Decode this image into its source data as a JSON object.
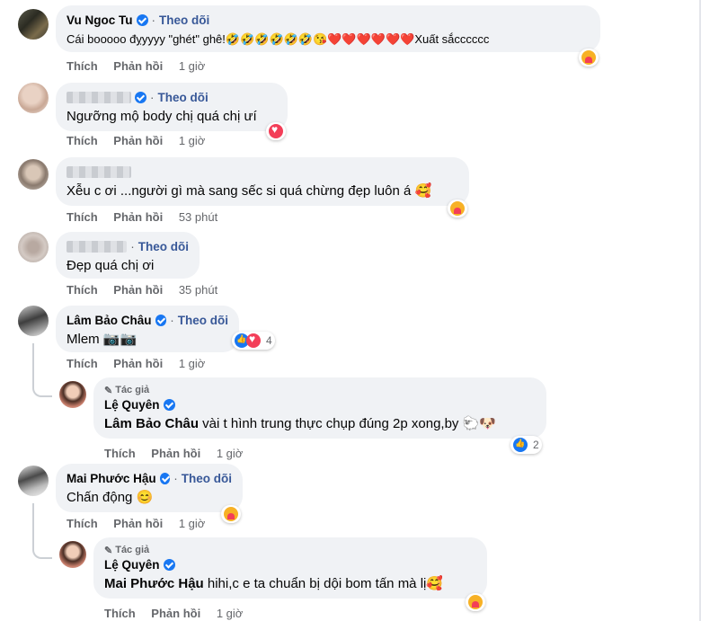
{
  "actions": {
    "like": "Thích",
    "reply": "Phản hồi"
  },
  "comments": [
    {
      "name": "Vu Ngoc Tu",
      "follow": "Theo dõi",
      "text": "Cái booooo đỵyyyy \"ghét\" ghê!🤣🤣🤣🤣🤣🤣😘❤️❤️❤️❤️❤️❤️Xuất sắcccccc",
      "time": "1 giờ",
      "reaction": "care-icon"
    },
    {
      "name": "",
      "follow": "Theo dõi",
      "text": "Ngưỡng mộ body chị quá chị ưí",
      "time": "1 giờ",
      "reaction": "love-icon"
    },
    {
      "name": "",
      "follow": "",
      "text": "Xễu c ơi ...người gì mà sang sếc si quá chừng đẹp luôn á 🥰",
      "time": "53 phút",
      "reaction": "care-icon"
    },
    {
      "name": "",
      "follow": "Theo dõi",
      "text": "Đẹp quá chị ơi",
      "time": "35 phút",
      "reaction": ""
    },
    {
      "name": "Lâm Bảo Châu",
      "follow": "Theo dõi",
      "text": "Mlem 📷📷",
      "time": "1 giờ",
      "reaction": "like-love-icon",
      "reaction_count": "4"
    },
    {
      "author_tag": "Tác giả",
      "name": "Lệ Quyên",
      "mention": "Lâm Bảo Châu",
      "text": " vài t hình trung thực chụp đúng 2p xong,by 🐑🐶",
      "time": "1 giờ",
      "reaction": "like-icon",
      "reaction_count": "2"
    },
    {
      "name": "Mai Phước Hậu",
      "follow": "Theo dõi",
      "text": "Chấn động 😊",
      "time": "1 giờ",
      "reaction": "care-icon"
    },
    {
      "author_tag": "Tác giả",
      "name": "Lệ Quyên",
      "mention": "Mai Phước Hậu",
      "text": " hihi,c e ta chuẩn bị dội bom tấn mà lị🥰",
      "time": "1 giờ",
      "reaction": "care-icon"
    }
  ],
  "colors": {
    "bubble": "#f0f2f5",
    "link": "#385898",
    "verified": "#1877f2",
    "meta": "#65676b"
  }
}
